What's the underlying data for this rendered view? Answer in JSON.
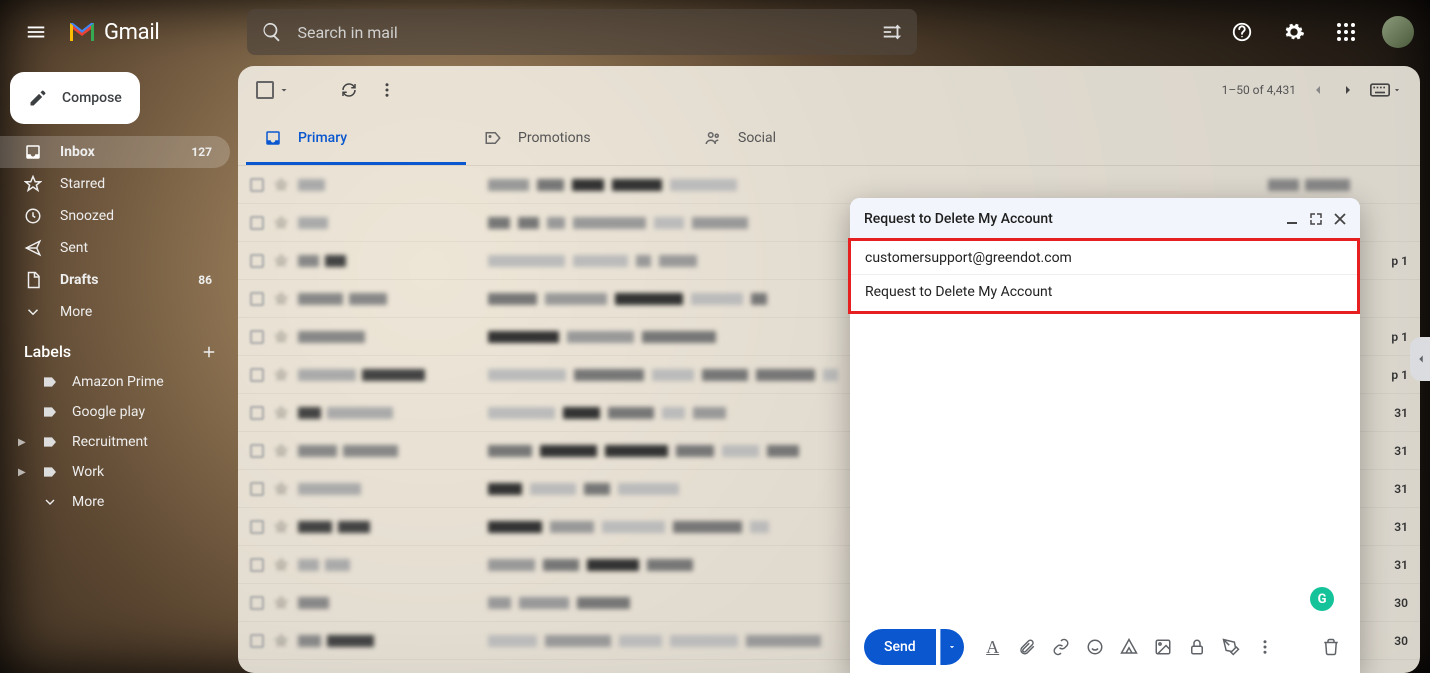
{
  "header": {
    "app_name": "Gmail",
    "search_placeholder": "Search in mail"
  },
  "sidebar": {
    "compose_label": "Compose",
    "items": [
      {
        "label": "Inbox",
        "count": "127"
      },
      {
        "label": "Starred",
        "count": ""
      },
      {
        "label": "Snoozed",
        "count": ""
      },
      {
        "label": "Sent",
        "count": ""
      },
      {
        "label": "Drafts",
        "count": "86"
      },
      {
        "label": "More",
        "count": ""
      }
    ],
    "labels_header": "Labels",
    "labels": [
      {
        "label": "Amazon Prime"
      },
      {
        "label": "Google play"
      },
      {
        "label": "Recruitment"
      },
      {
        "label": "Work"
      },
      {
        "label": "More"
      }
    ]
  },
  "toolbar": {
    "pager_text": "1–50 of 4,431"
  },
  "tabs": [
    {
      "label": "Primary"
    },
    {
      "label": "Promotions"
    },
    {
      "label": "Social"
    }
  ],
  "emails": {
    "dates": [
      "",
      "",
      "p 1",
      "",
      "p 1",
      "p 1",
      "31",
      "31",
      "31",
      "31",
      "31",
      "30",
      "30"
    ]
  },
  "compose": {
    "title": "Request to Delete My Account",
    "to": "customersupport@greendot.com",
    "subject": "Request to Delete My Account",
    "send_label": "Send"
  }
}
